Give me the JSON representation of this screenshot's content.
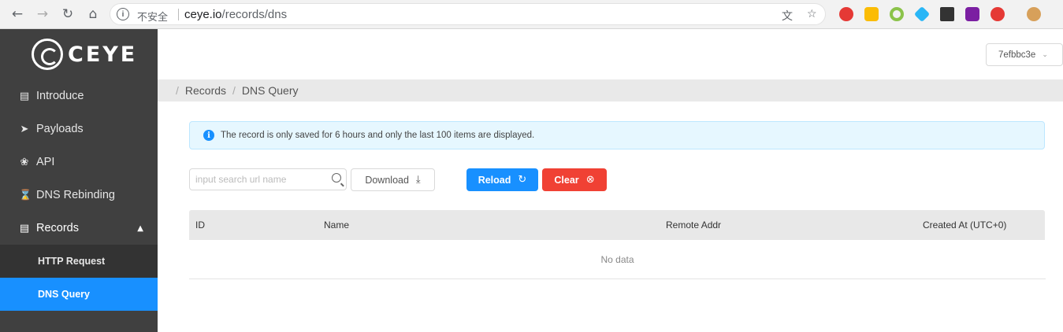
{
  "browser": {
    "info_icon": "info-icon",
    "security_label": "不安全",
    "url_host": "ceye.io",
    "url_path": "/records/dns"
  },
  "sidebar": {
    "logo_text": "CEYE",
    "items": [
      {
        "label": "Introduce",
        "icon": "document-icon"
      },
      {
        "label": "Payloads",
        "icon": "rocket-icon"
      },
      {
        "label": "API",
        "icon": "api-icon"
      },
      {
        "label": "DNS Rebinding",
        "icon": "hourglass-icon"
      },
      {
        "label": "Records",
        "icon": "records-icon"
      }
    ],
    "submenu": [
      {
        "label": "HTTP Request"
      },
      {
        "label": "DNS Query"
      }
    ],
    "active": "DNS Query"
  },
  "header": {
    "user": "7efbbc3e"
  },
  "breadcrumb": [
    "Records",
    "DNS Query"
  ],
  "alert": {
    "text": "The record is only saved for 6 hours and only the last 100 items are displayed."
  },
  "toolbar": {
    "search_placeholder": "input search url name",
    "search_value": "",
    "download_label": "Download",
    "reload_label": "Reload",
    "clear_label": "Clear"
  },
  "table": {
    "columns": [
      "ID",
      "Name",
      "Remote Addr",
      "Created At (UTC+0)"
    ],
    "rows": [],
    "empty_text": "No data"
  },
  "colors": {
    "sidebar_bg": "#404040",
    "active_item": "#1890ff",
    "reload_button": "#1890ff",
    "clear_button": "#f04134",
    "alert_bg": "#e6f7ff"
  }
}
